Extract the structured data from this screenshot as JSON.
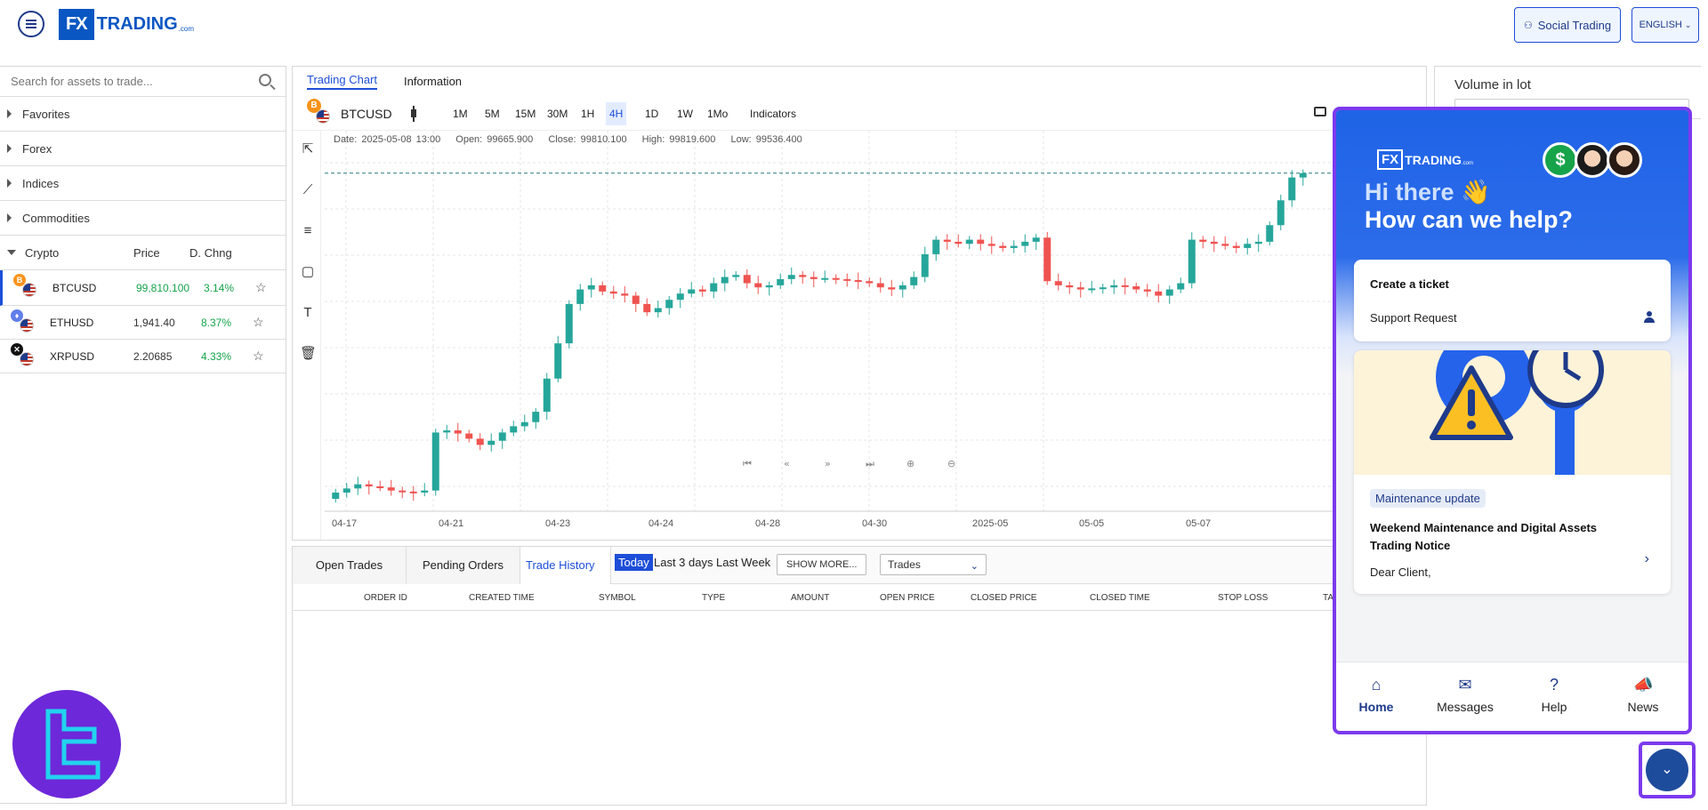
{
  "header": {
    "logo": {
      "fx": "FX",
      "word": "TRADING",
      "suffix": ".com"
    },
    "social_trading": "Social Trading",
    "language": "ENGLISH"
  },
  "assets": {
    "search_placeholder": "Search for assets to trade...",
    "categories": [
      "Favorites",
      "Forex",
      "Indices",
      "Commodities"
    ],
    "crypto_header": {
      "name": "Crypto",
      "price": "Price",
      "change": "D. Chng"
    },
    "rows": [
      {
        "symbol": "BTCUSD",
        "price": "99,810.100",
        "change": "3.14%",
        "coin_color": "#f7931a",
        "coin_glyph": "B"
      },
      {
        "symbol": "ETHUSD",
        "price": "1,941.40",
        "change": "8.37%",
        "coin_color": "#627eea",
        "coin_glyph": "♦"
      },
      {
        "symbol": "XRPUSD",
        "price": "2.20685",
        "change": "4.33%",
        "coin_color": "#111111",
        "coin_glyph": "✕"
      }
    ]
  },
  "chart": {
    "tabs": [
      "Trading Chart",
      "Information"
    ],
    "symbol": "BTCUSD",
    "timeframes": [
      "1M",
      "5M",
      "15M",
      "30M",
      "1H",
      "4H",
      "1D",
      "1W",
      "1Mo"
    ],
    "active_timeframe": "4H",
    "indicators": "Indicators",
    "ohlc": {
      "date": "Date: 2025-05-08 13:00",
      "open": "Open: 99665.900",
      "close": "Close: 99810.100",
      "high": "High: 99819.600",
      "low": "Low: 99536.400"
    },
    "x_labels": [
      "04-17",
      "04-21",
      "04-23",
      "04-24",
      "04-28",
      "04-30",
      "2025-05",
      "05-05",
      "05-07"
    ]
  },
  "chart_data": {
    "type": "candlestick",
    "symbol": "BTCUSD",
    "interval": "4H",
    "x_tick_labels": [
      "04-17",
      "04-21",
      "04-23",
      "04-24",
      "04-28",
      "04-30",
      "2025-05",
      "05-05",
      "05-07"
    ],
    "last_candle": {
      "date": "2025-05-08 13:00",
      "open": 99665.9,
      "close": 99810.1,
      "high": 99819.6,
      "low": 99536.4
    },
    "up_color": "#26a69a",
    "down_color": "#ef5350",
    "grid": true,
    "closes": [
      84400,
      84600,
      84800,
      84700,
      84650,
      84500,
      84450,
      84400,
      84500,
      87300,
      87400,
      87250,
      87000,
      86700,
      86900,
      87300,
      87600,
      87800,
      88300,
      89900,
      91600,
      93500,
      94200,
      94400,
      94100,
      94000,
      93900,
      93500,
      93100,
      93300,
      93700,
      94000,
      94200,
      94100,
      94500,
      94800,
      94900,
      94500,
      94300,
      94400,
      94700,
      94900,
      94800,
      94700,
      94750,
      94700,
      94650,
      94600,
      94500,
      94300,
      94200,
      94400,
      94800,
      95900,
      96600,
      96500,
      96400,
      96600,
      96400,
      96300,
      96200,
      96300,
      96500,
      96700,
      94600,
      94400,
      94300,
      94200,
      94250,
      94300,
      94400,
      94350,
      94200,
      94100,
      93900,
      94200,
      94500,
      96600,
      96500,
      96400,
      96300,
      96200,
      96400,
      96500,
      97300,
      98500,
      99600,
      99810.1
    ]
  },
  "trades": {
    "tabs": [
      "Open Trades",
      "Pending Orders",
      "Trade History"
    ],
    "active_tab": "Trade History",
    "periods": [
      "Today",
      "Last 3 days",
      "Last Week"
    ],
    "active_period": "Today",
    "show_more": "SHOW MORE...",
    "filter": "Trades",
    "columns": [
      "ORDER ID",
      "CREATED TIME",
      "SYMBOL",
      "TYPE",
      "AMOUNT",
      "OPEN PRICE",
      "CLOSED PRICE",
      "CLOSED TIME",
      "STOP LOSS",
      "TA"
    ]
  },
  "order": {
    "volume_label": "Volume in lot"
  },
  "chat": {
    "logo": {
      "fx": "FX",
      "word": "TRADING",
      "suffix": ".com"
    },
    "greeting": "Hi there 👋",
    "question": "How can we help?",
    "ticket": {
      "title": "Create a ticket",
      "subtitle": "Support Request"
    },
    "news": {
      "badge": "Maintenance update",
      "title": "Weekend Maintenance and Digital Assets Trading Notice",
      "body": "Dear Client,"
    },
    "nav": [
      "Home",
      "Messages",
      "Help",
      "News"
    ],
    "active_nav": "Home"
  }
}
